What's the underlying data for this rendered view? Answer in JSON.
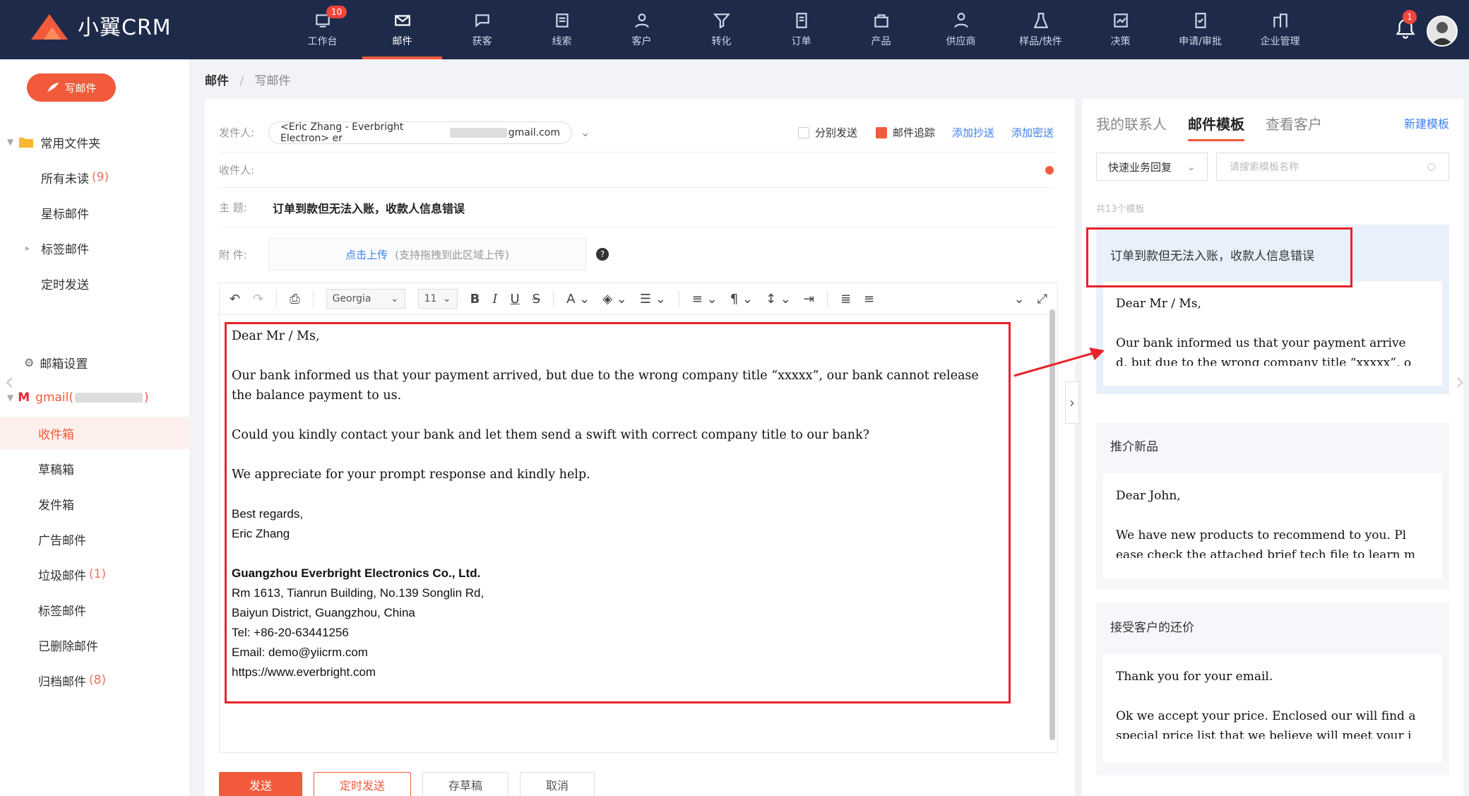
{
  "app": {
    "title": "小翼CRM"
  },
  "nav": [
    {
      "label": "工作台",
      "badge": "10",
      "icon": "workbench-icon"
    },
    {
      "label": "邮件",
      "icon": "mail-icon",
      "active": true
    },
    {
      "label": "获客",
      "icon": "acquire-icon"
    },
    {
      "label": "线索",
      "icon": "lead-icon"
    },
    {
      "label": "客户",
      "icon": "customer-icon"
    },
    {
      "label": "转化",
      "icon": "funnel-icon"
    },
    {
      "label": "订单",
      "icon": "order-icon"
    },
    {
      "label": "产品",
      "icon": "product-icon"
    },
    {
      "label": "供应商",
      "icon": "supplier-icon"
    },
    {
      "label": "样品/快件",
      "icon": "sample-icon"
    },
    {
      "label": "决策",
      "icon": "decision-icon"
    },
    {
      "label": "申请/审批",
      "icon": "approval-icon"
    },
    {
      "label": "企业管理",
      "icon": "enterprise-icon"
    }
  ],
  "header": {
    "notification_count": "1"
  },
  "sidebar": {
    "compose": "写邮件",
    "common_folder": "常用文件夹",
    "items": [
      {
        "label": "所有未读",
        "count": "(9)"
      },
      {
        "label": "星标邮件",
        "count": ""
      },
      {
        "label": "标签邮件",
        "count": ""
      },
      {
        "label": "定时发送",
        "count": ""
      }
    ],
    "settings": "邮箱设置",
    "account_prefix": "gmail(",
    "account_suffix": ")",
    "folders": [
      {
        "label": "收件箱",
        "count": "",
        "active": true
      },
      {
        "label": "草稿箱",
        "count": ""
      },
      {
        "label": "发件箱",
        "count": ""
      },
      {
        "label": "广告邮件",
        "count": ""
      },
      {
        "label": "垃圾邮件",
        "count": "(1)"
      },
      {
        "label": "标签邮件",
        "count": ""
      },
      {
        "label": "已删除邮件",
        "count": ""
      },
      {
        "label": "归档邮件",
        "count": "(8)"
      }
    ]
  },
  "breadcrumb": {
    "root": "邮件",
    "sep": "/",
    "current": "写邮件"
  },
  "compose": {
    "from_label": "发件人:",
    "from_name": "<Eric Zhang - Everbright Electron> er",
    "from_domain": "gmail.com",
    "separate_send": "分别发送",
    "track": "邮件追踪",
    "add_cc": "添加抄送",
    "add_bcc": "添加密送",
    "to_label": "收件人:",
    "subject_label": "主  题:",
    "subject": "订单到款但无法入账，收款人信息错误",
    "attach_label": "附  件:",
    "upload_link": "点击上传",
    "upload_hint": "(支持拖拽到此区域上传)",
    "font": "Georgia",
    "size": "11",
    "body": {
      "greeting": "Dear Mr / Ms,",
      "p1": "Our bank informed us that your payment arrived, but due to the wrong company title “xxxxx”, our bank cannot release the balance payment to us.",
      "p2": "Could you kindly contact your bank and let them send a swift with correct company title to our bank?",
      "p3": "We appreciate for your prompt response and kindly help.",
      "closing": "Best regards,",
      "name": "Eric Zhang",
      "company": "Guangzhou Everbright Electronics Co., Ltd.",
      "addr1": "Rm 1613, Tianrun Building, No.139 Songlin Rd,",
      "addr2": "Baiyun District, Guangzhou, China",
      "tel": "Tel: +86-20-63441256",
      "email": "Email: demo@yiicrm.com",
      "web": "https://www.everbright.com"
    },
    "buttons": {
      "send": "发送",
      "schedule": "定时发送",
      "draft": "存草稿",
      "cancel": "取消"
    }
  },
  "templates": {
    "tabs": [
      "我的联系人",
      "邮件模板",
      "查看客户"
    ],
    "new": "新建模板",
    "category": "快速业务回复",
    "search_placeholder": "请搜索模板名称",
    "count": "共13个模板",
    "cards": [
      {
        "title": "订单到款但无法入账，收款人信息错误",
        "line1": "Dear Mr / Ms,",
        "line2": "Our bank informed us that your payment arrive",
        "line3": "d, but due to the wrong company title “xxxxx”, o"
      },
      {
        "title": "推介新品",
        "line1": "Dear John,",
        "line2": "We have new products to recommend to you. Pl",
        "line3": "ease check the attached brief tech file to learn m"
      },
      {
        "title": "接受客户的还价",
        "line1": "Thank you for your email.",
        "line2": "Ok we accept your price. Enclosed our will find a",
        "line3": "special price list that we believe will meet your i"
      }
    ]
  },
  "colors": {
    "accent": "#f15a3b",
    "nav_bg": "#1e2a4a",
    "link": "#3d7ff0",
    "highlight": "#e8232b"
  }
}
